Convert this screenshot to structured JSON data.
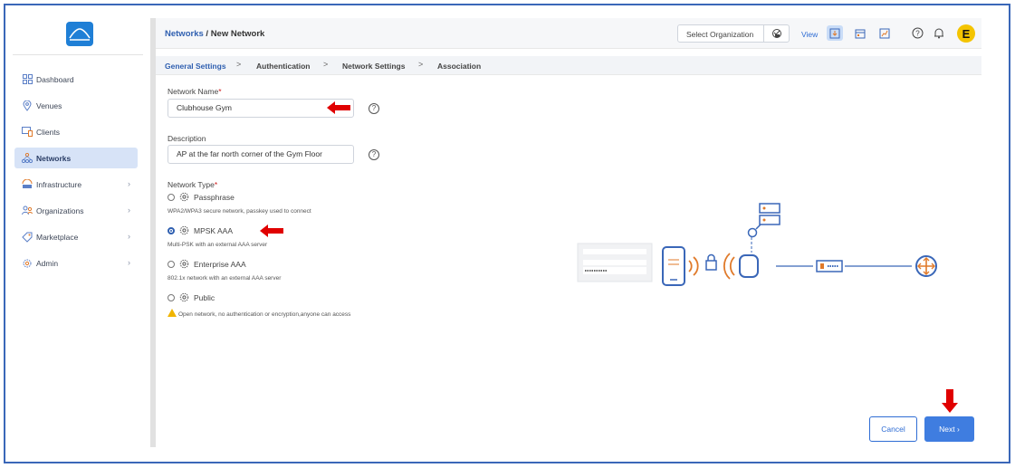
{
  "sidebar": {
    "items": [
      {
        "label": "Dashboard"
      },
      {
        "label": "Venues"
      },
      {
        "label": "Clients"
      },
      {
        "label": "Networks"
      },
      {
        "label": "Infrastructure"
      },
      {
        "label": "Organizations"
      },
      {
        "label": "Marketplace"
      },
      {
        "label": "Admin"
      }
    ],
    "active": "Networks",
    "chevron": "›"
  },
  "header": {
    "breadcrumb_link": "Networks",
    "breadcrumb_sep": " / ",
    "breadcrumb_current": "New Network",
    "org_select_label": "Select Organization",
    "view_label": "View",
    "avatar_letter": "E"
  },
  "tabs": [
    {
      "label": "General Settings"
    },
    {
      "label": "Authentication"
    },
    {
      "label": "Network Settings"
    },
    {
      "label": "Association"
    }
  ],
  "tab_separator": ">",
  "form": {
    "network_name_label": "Network Name",
    "network_name_value": "Clubhouse Gym",
    "description_label": "Description",
    "description_value": "AP at the far north corner of the Gym Floor",
    "required_mark": "*",
    "help_glyph": "?",
    "network_type_label": "Network Type",
    "types": [
      {
        "label": "Passphrase",
        "desc": "WPA2/WPA3 secure network, passkey used to connect",
        "selected": false
      },
      {
        "label": "MPSK AAA",
        "desc": "Multi-PSK with an external AAA server",
        "selected": true
      },
      {
        "label": "Enterprise AAA",
        "desc": "802.1x network with an external AAA server",
        "selected": false
      },
      {
        "label": "Public",
        "desc": "Open network, no authentication or encryption,anyone can access",
        "selected": false
      }
    ]
  },
  "buttons": {
    "cancel": "Cancel",
    "next": "Next",
    "next_chevron": "›"
  },
  "colors": {
    "accent": "#2f5fb0",
    "primary_button": "#3f7de0",
    "annotation_arrow": "#e00000",
    "avatar": "#f4c400",
    "frame": "#3a67b8"
  }
}
